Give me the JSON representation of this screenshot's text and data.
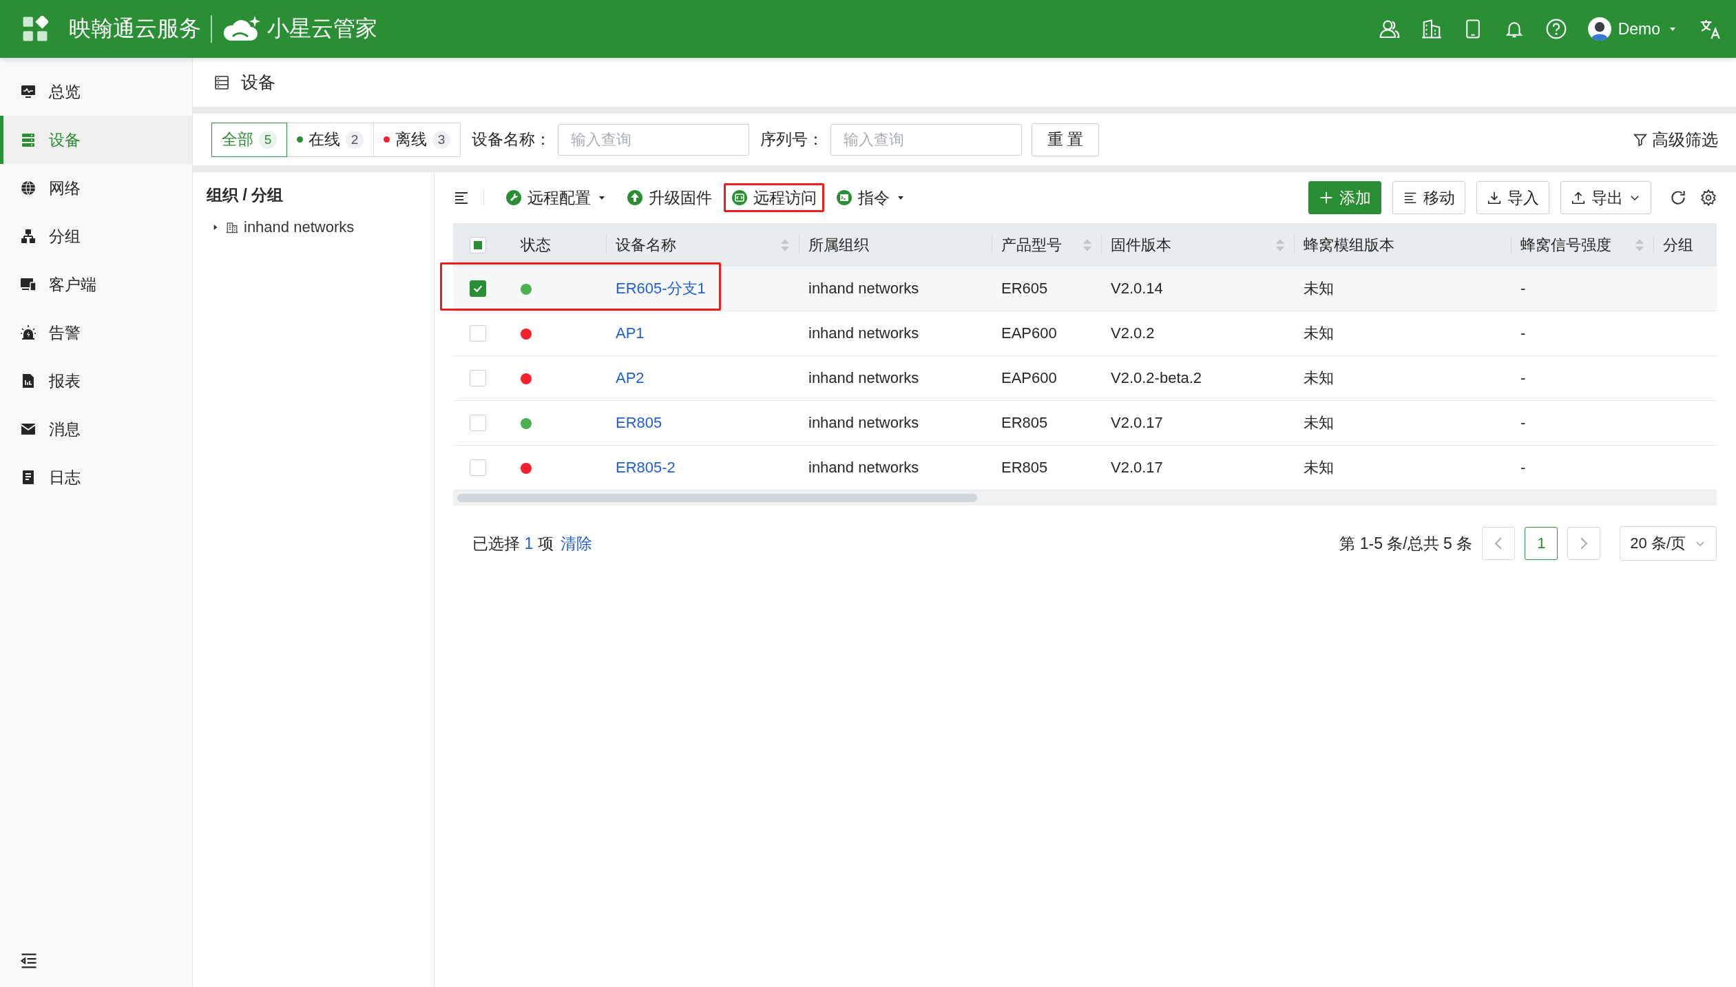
{
  "header": {
    "brand": "映翰通云服务",
    "product": "小星云管家",
    "user": "Demo"
  },
  "sidebar": {
    "items": [
      {
        "label": "总览",
        "selected": false
      },
      {
        "label": "设备",
        "selected": true
      },
      {
        "label": "网络",
        "selected": false
      },
      {
        "label": "分组",
        "selected": false
      },
      {
        "label": "客户端",
        "selected": false
      },
      {
        "label": "告警",
        "selected": false
      },
      {
        "label": "报表",
        "selected": false
      },
      {
        "label": "消息",
        "selected": false
      },
      {
        "label": "日志",
        "selected": false
      }
    ]
  },
  "page": {
    "title": "设备"
  },
  "filters": {
    "status_tabs": [
      {
        "label": "全部",
        "count": "5",
        "selected": true
      },
      {
        "label": "在线",
        "count": "2",
        "selected": false,
        "color": "#2a8f34"
      },
      {
        "label": "离线",
        "count": "3",
        "selected": false,
        "color": "#f5222d"
      }
    ],
    "fields": [
      {
        "label": "设备名称：",
        "placeholder": "输入查询"
      },
      {
        "label": "序列号：",
        "placeholder": "输入查询"
      }
    ],
    "reset": "重 置",
    "advanced": "高级筛选"
  },
  "org_panel": {
    "title": "组织 / 分组",
    "tree": [
      {
        "label": "inhand networks",
        "expanded": false
      }
    ]
  },
  "toolbar": {
    "actions": [
      {
        "label": "远程配置",
        "dropdown": true,
        "highlighted": false
      },
      {
        "label": "升级固件",
        "dropdown": false,
        "highlighted": false
      },
      {
        "label": "远程访问",
        "dropdown": false,
        "highlighted": true
      },
      {
        "label": "指令",
        "dropdown": true,
        "highlighted": false
      }
    ],
    "buttons": [
      {
        "label": "添加",
        "kind": "primary"
      },
      {
        "label": "移动",
        "kind": "default"
      },
      {
        "label": "导入",
        "kind": "default"
      },
      {
        "label": "导出",
        "kind": "dropdown"
      }
    ]
  },
  "table": {
    "indeterminate": true,
    "columns": [
      {
        "label": "状态",
        "sortable": false
      },
      {
        "label": "设备名称",
        "sortable": true
      },
      {
        "label": "所属组织",
        "sortable": false
      },
      {
        "label": "产品型号",
        "sortable": true
      },
      {
        "label": "固件版本",
        "sortable": true
      },
      {
        "label": "蜂窝模组版本",
        "sortable": false
      },
      {
        "label": "蜂窝信号强度",
        "sortable": true
      },
      {
        "label": "分组",
        "sortable": false
      }
    ],
    "rows": [
      {
        "selected": true,
        "highlighted": true,
        "color": "#4cb050",
        "name": "ER605-分支1",
        "org": "inhand networks",
        "model": "ER605",
        "firmware": "V2.0.14",
        "module": "未知",
        "signal": "-"
      },
      {
        "selected": false,
        "highlighted": false,
        "color": "#f5222d",
        "name": "AP1",
        "org": "inhand networks",
        "model": "EAP600",
        "firmware": "V2.0.2",
        "module": "未知",
        "signal": "-"
      },
      {
        "selected": false,
        "highlighted": false,
        "color": "#f5222d",
        "name": "AP2",
        "org": "inhand networks",
        "model": "EAP600",
        "firmware": "V2.0.2-beta.2",
        "module": "未知",
        "signal": "-"
      },
      {
        "selected": false,
        "highlighted": false,
        "color": "#4cb050",
        "name": "ER805",
        "org": "inhand networks",
        "model": "ER805",
        "firmware": "V2.0.17",
        "module": "未知",
        "signal": "-"
      },
      {
        "selected": false,
        "highlighted": false,
        "color": "#f5222d",
        "name": "ER805-2",
        "org": "inhand networks",
        "model": "ER805",
        "firmware": "V2.0.17",
        "module": "未知",
        "signal": "-"
      }
    ]
  },
  "selection": {
    "summary": "已选择 **1** 项",
    "clear": "清除"
  },
  "pagination": {
    "range": "第 1-5 条/总共 5 条",
    "pages": [
      {
        "label": "1",
        "selected": true
      }
    ],
    "page_size": "20 条/页"
  }
}
